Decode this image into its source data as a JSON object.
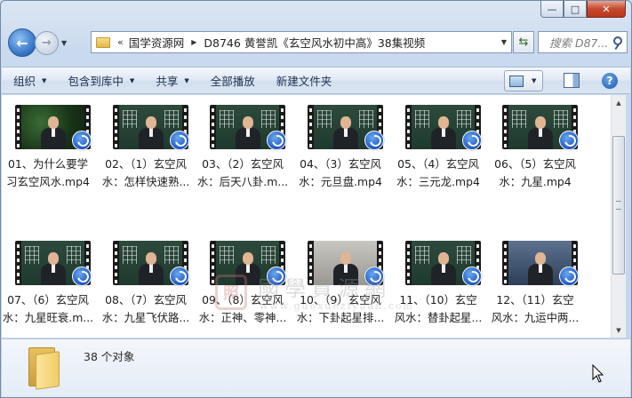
{
  "window": {
    "caption_buttons": [
      "minimize",
      "maximize",
      "close"
    ]
  },
  "nav": {
    "back_icon": "back-arrow-icon",
    "forward_icon": "forward-arrow-icon",
    "address_chevron": "«",
    "breadcrumbs": [
      "国学资源网",
      "D8746 黄誉凯《玄空风水初中高》38集视频"
    ],
    "search_placeholder": "搜索 D87..."
  },
  "toolbar": {
    "organize": "组织",
    "include_in_library": "包含到库中",
    "share": "共享",
    "play_all": "全部播放",
    "new_folder": "新建文件夹"
  },
  "files": [
    {
      "line1": "01、为什么要学",
      "line2": "习玄空风水.mp4",
      "thumb": "forest"
    },
    {
      "line1": "02、（1）玄空风",
      "line2": "水：怎样快速熟...",
      "thumb": "board"
    },
    {
      "line1": "03、（2）玄空风",
      "line2": "水：后天八卦.m...",
      "thumb": "board"
    },
    {
      "line1": "04、（3）玄空风",
      "line2": "水：元旦盘.mp4",
      "thumb": "board"
    },
    {
      "line1": "05、（4）玄空风",
      "line2": "水：三元龙.mp4",
      "thumb": "board"
    },
    {
      "line1": "06、（5）玄空风",
      "line2": "水：九星.mp4",
      "thumb": "board"
    },
    {
      "line1": "07、（6）玄空风",
      "line2": "水：九星旺衰.m...",
      "thumb": "board"
    },
    {
      "line1": "08、（7）玄空风",
      "line2": "水：九星飞伏路...",
      "thumb": "board"
    },
    {
      "line1": "09、（8）玄空风",
      "line2": "水：正神、零神...",
      "thumb": "board"
    },
    {
      "line1": "10、（9）玄空风",
      "line2": "水：下卦起星排...",
      "thumb": "light"
    },
    {
      "line1": "11、（10）玄空",
      "line2": "风水：替卦起星...",
      "thumb": "board"
    },
    {
      "line1": "12、（11）玄空",
      "line2": "风水：九运中两...",
      "thumb": "blue"
    }
  ],
  "watermark": {
    "seal": "照",
    "chinese": "國學資源網",
    "url": "www.guoxueziyuan.com"
  },
  "details": {
    "count": "38 个对象"
  },
  "colors": {
    "accent": "#2f6fc4",
    "close": "#c6492d",
    "folder": "#f0cd6a"
  }
}
